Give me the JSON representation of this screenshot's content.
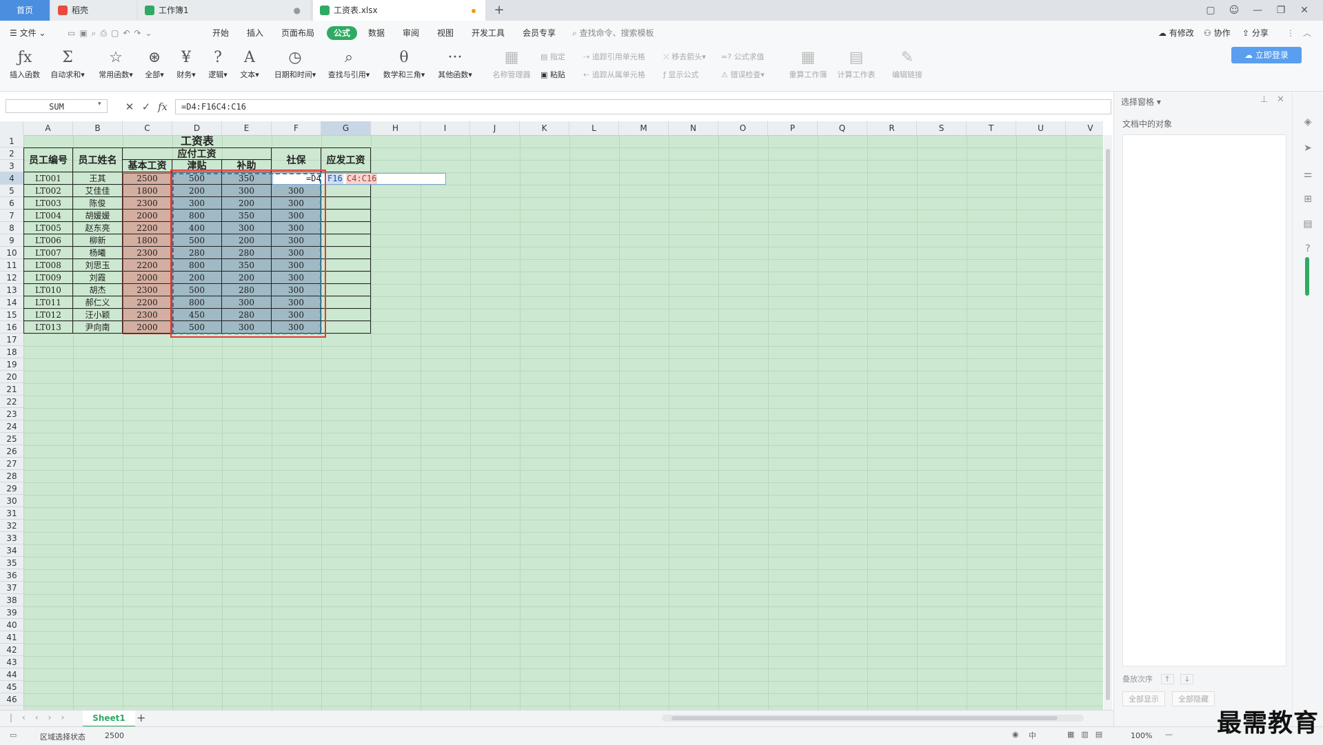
{
  "tabs": {
    "home": "首页",
    "tab1": "稻壳",
    "tab2": "工作簿1",
    "tab3": "工资表.xlsx",
    "new_tab": "+"
  },
  "menu": {
    "file": "文件",
    "items": [
      "开始",
      "插入",
      "页面布局",
      "公式",
      "数据",
      "审阅",
      "视图",
      "开发工具",
      "会员专享"
    ],
    "active": "公式",
    "search_placeholder": "查找命令、搜索模板",
    "right": [
      "有修改",
      "协作",
      "分享"
    ]
  },
  "ribbon": {
    "buttons": [
      "插入函数",
      "自动求和",
      "常用函数",
      "全部",
      "财务",
      "逻辑",
      "文本",
      "日期和时间",
      "查找与引用",
      "数学和三角",
      "其他函数",
      "名称管理器"
    ],
    "small": [
      "指定",
      "粘贴",
      "追踪引用单元格",
      "追踪从属单元格",
      "移去箭头",
      "显示公式",
      "公式求值",
      "错误检查"
    ],
    "big_right": [
      "重算工作簿",
      "计算工作表",
      "编辑链接"
    ],
    "login": "立即登录"
  },
  "formula_bar": {
    "name_box": "SUM",
    "formula": "=D4:F16C4:C16"
  },
  "columns": [
    "A",
    "B",
    "C",
    "D",
    "E",
    "F",
    "G",
    "H",
    "I",
    "J",
    "K",
    "L",
    "M",
    "N",
    "O",
    "P",
    "Q",
    "R",
    "S",
    "T",
    "U",
    "V"
  ],
  "rows_count": 46,
  "sheet": {
    "title": "工资表",
    "headers": {
      "emp_id": "员工编号",
      "emp_name": "员工姓名",
      "payable": "应付工资",
      "base": "基本工资",
      "allowance": "津贴",
      "subsidy": "补助",
      "social": "社保",
      "net": "应发工资"
    },
    "editing_text": {
      "part1": "=D4",
      "part2": "F16",
      "part3": "C4:C16"
    },
    "rows": [
      {
        "id": "LT001",
        "name": "王其",
        "base": "2500",
        "allowance": "500",
        "subsidy": "350",
        "social": ""
      },
      {
        "id": "LT002",
        "name": "艾佳佳",
        "base": "1800",
        "allowance": "200",
        "subsidy": "300",
        "social": "300"
      },
      {
        "id": "LT003",
        "name": "陈俊",
        "base": "2300",
        "allowance": "300",
        "subsidy": "200",
        "social": "300"
      },
      {
        "id": "LT004",
        "name": "胡媛媛",
        "base": "2000",
        "allowance": "800",
        "subsidy": "350",
        "social": "300"
      },
      {
        "id": "LT005",
        "name": "赵东亮",
        "base": "2200",
        "allowance": "400",
        "subsidy": "300",
        "social": "300"
      },
      {
        "id": "LT006",
        "name": "柳新",
        "base": "1800",
        "allowance": "500",
        "subsidy": "200",
        "social": "300"
      },
      {
        "id": "LT007",
        "name": "杨曦",
        "base": "2300",
        "allowance": "280",
        "subsidy": "280",
        "social": "300"
      },
      {
        "id": "LT008",
        "name": "刘思玉",
        "base": "2200",
        "allowance": "800",
        "subsidy": "350",
        "social": "300"
      },
      {
        "id": "LT009",
        "name": "刘霞",
        "base": "2000",
        "allowance": "200",
        "subsidy": "200",
        "social": "300"
      },
      {
        "id": "LT010",
        "name": "胡杰",
        "base": "2300",
        "allowance": "500",
        "subsidy": "280",
        "social": "300"
      },
      {
        "id": "LT011",
        "name": "郝仁义",
        "base": "2200",
        "allowance": "800",
        "subsidy": "300",
        "social": "300"
      },
      {
        "id": "LT012",
        "name": "汪小颖",
        "base": "2300",
        "allowance": "450",
        "subsidy": "280",
        "social": "300"
      },
      {
        "id": "LT013",
        "name": "尹向南",
        "base": "2000",
        "allowance": "500",
        "subsidy": "300",
        "social": "300"
      }
    ]
  },
  "right_panel": {
    "title": "选择窗格",
    "subtitle": "文档中的对象",
    "order_label": "叠放次序",
    "show_all": "全部显示",
    "hide_all": "全部隐藏"
  },
  "sheet_tabs": {
    "active": "Sheet1",
    "add": "+"
  },
  "status": {
    "mode": "区域选择状态",
    "value": "2500",
    "zoom": "100%"
  },
  "watermark": "最需教育",
  "colors": {
    "accent": "#2faa63",
    "sheet_bg": "#cde8d0",
    "base_fill": "#d4aea0",
    "range_fill": "#9fb9c5",
    "selection_box": "#e53935"
  }
}
